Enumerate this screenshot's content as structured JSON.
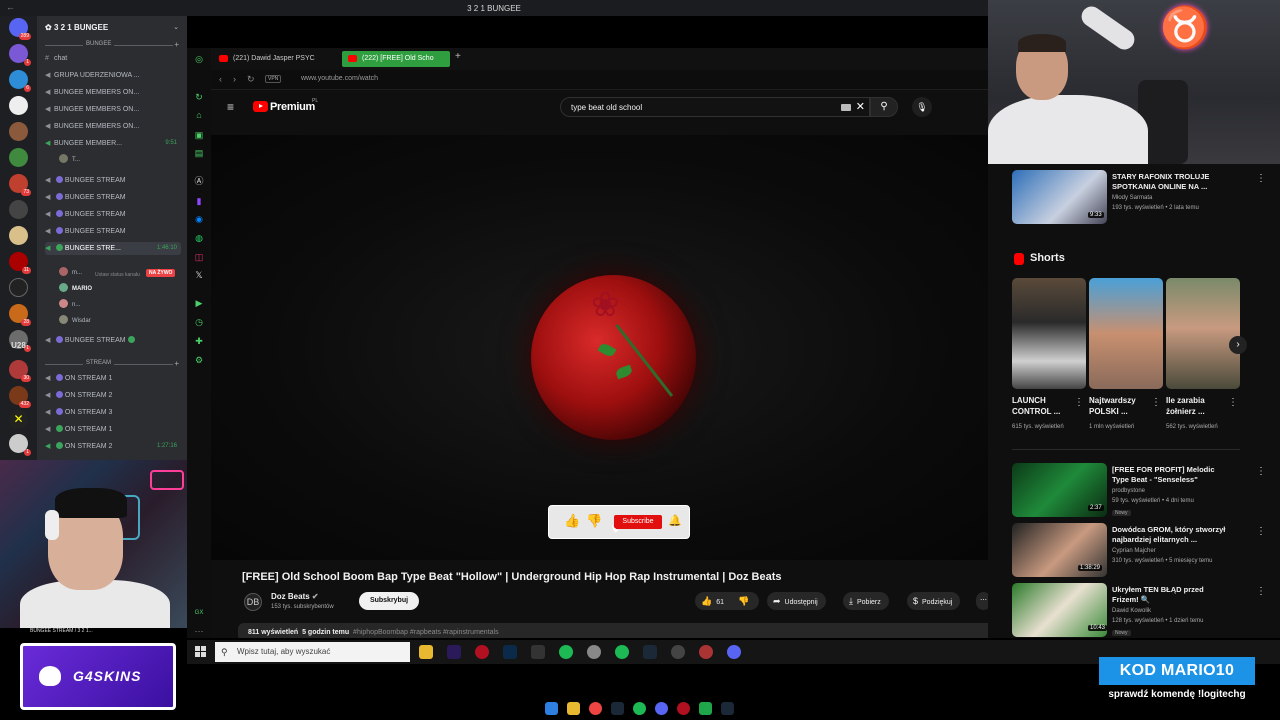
{
  "window": {
    "title": "3 2 1 BUNGEE"
  },
  "discord": {
    "server_name": "3 2 1 BUNGEE",
    "server_badges": [
      "289",
      "1",
      "6",
      "73",
      "11",
      "28",
      "1",
      "U28",
      "30",
      "432",
      "1"
    ],
    "categories": {
      "bungee": "BUNGEE",
      "stream": "STREAM"
    },
    "channels": [
      {
        "name": "chat",
        "time": ""
      },
      {
        "name": "GRUPA UDERZENIOWA ...",
        "time": ""
      },
      {
        "name": "BUNGEE MEMBERS ON...",
        "time": ""
      },
      {
        "name": "BUNGEE MEMBERS ON...",
        "time": ""
      },
      {
        "name": "BUNGEE MEMBERS ON...",
        "time": ""
      },
      {
        "name": "BUNGEE MEMBER...",
        "time": "9:51"
      },
      {
        "name": "BUNGEE STREAM",
        "time": ""
      },
      {
        "name": "BUNGEE STREAM",
        "time": ""
      },
      {
        "name": "BUNGEE STREAM",
        "time": ""
      },
      {
        "name": "BUNGEE STREAM",
        "time": ""
      },
      {
        "name": "BUNGEE STRE...",
        "time": "1:46:10"
      },
      {
        "name": "BUNGEE STREAM",
        "time": ""
      },
      {
        "name": "ON STREAM 1",
        "time": ""
      },
      {
        "name": "ON STREAM 2",
        "time": ""
      },
      {
        "name": "ON STREAM 3",
        "time": ""
      },
      {
        "name": "ON STREAM 1",
        "time": ""
      },
      {
        "name": "ON STREAM 2",
        "time": "1:27:16"
      }
    ],
    "status_text": "Ustaw status kanału",
    "members": [
      "m...",
      "MARIO",
      "n...",
      "Wisdar"
    ],
    "t_member": "T...",
    "live_label": "NA ŻYWO",
    "overlay_footer": "BUNGEE STREAM / 3 2 1..."
  },
  "browser": {
    "tabs": [
      {
        "label": "(221) Dawid Jasper PSYC"
      },
      {
        "label": "(222) [FREE] Old Scho"
      }
    ],
    "vpn": "VPN",
    "url": "www.youtube.com/watch"
  },
  "youtube": {
    "brand": "Premium",
    "country": "PL",
    "search_query": "type beat old school",
    "video": {
      "title": "[FREE] Old School Boom Bap Type Beat \"Hollow\" | Underground Hip Hop Rap Instrumental | Doz Beats",
      "channel": "Doz Beats",
      "channel_initials": "DB",
      "subscribers": "153 tys. subskrybentów",
      "subscribe_label": "Subskrybuj",
      "likes": "61",
      "share": "Udostępnij",
      "download": "Pobierz",
      "thanks": "Podziękuj",
      "views": "811 wyświetleń",
      "age": "5 godzin temu",
      "tags": "#hiphopBoombap #rapbeats #rapinstrumentals",
      "overlay_subscribe": "Subscribe"
    },
    "top_rec": {
      "title": "STARY RAFONIX TROLUJE SPOTKANIA ONLINE NA ...",
      "channel": "Młody Sarmata",
      "meta": "193 tys. wyświetleń • 2 lata temu",
      "duration": "9:33"
    },
    "shorts_label": "Shorts",
    "shorts": [
      {
        "title": "LAUNCH CONTROL ...",
        "views": "615 tys. wyświetleń"
      },
      {
        "title": "Najtwardszy POLSKI ...",
        "views": "1 mln wyświetleń"
      },
      {
        "title": "Ile zarabia żołnierz ...",
        "views": "562 tys. wyświetleń"
      }
    ],
    "recs": [
      {
        "title": "[FREE FOR PROFIT] Melodic Type Beat - \"Senseless\"",
        "channel": "prodbystone",
        "meta": "59 tys. wyświetleń • 4 dni temu",
        "badge": "Nowy",
        "duration": "2:37"
      },
      {
        "title": "Dowódca GROM, który stworzył najbardziej elitarnych ...",
        "channel": "Cyprian Majcher",
        "meta": "310 tys. wyświetleń • 5 miesięcy temu",
        "badge": "",
        "duration": "1:38:29"
      },
      {
        "title": "Ukryłem TEN BŁĄD przed Frizem! 🔍",
        "channel": "Dawid Kowolik",
        "meta": "128 tys. wyświetleń • 1 dzień temu",
        "badge": "Nowy",
        "duration": "10:43"
      }
    ]
  },
  "windows": {
    "search_placeholder": "Wpisz tutaj, aby wyszukać"
  },
  "overlays": {
    "sponsor": "G4SKINS",
    "promo_code": "KOD MARIO10",
    "promo_sub": "sprawdź komendę !logitechg"
  }
}
